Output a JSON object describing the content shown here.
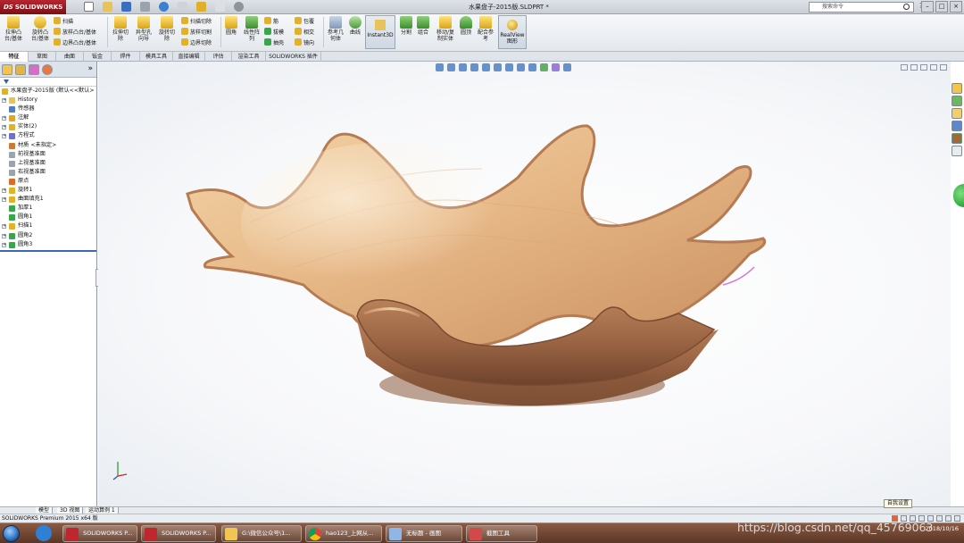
{
  "app": {
    "logo_text": "SOLIDWORKS",
    "logo_prefix": "DS",
    "document_title": "水果盘子-2015版.SLDPRT *",
    "search_placeholder": "搜索命令",
    "help_label": "? ·"
  },
  "window_controls": [
    "–",
    "□",
    "×"
  ],
  "commands": {
    "extrude_boss": "拉伸凸台/基体",
    "revolve_boss": "旋转凸台/基体",
    "sweep": "扫描",
    "loft_boss": "放样凸台/基体",
    "boundary_boss": "边界凸台/基体",
    "extrude_cut": "拉伸切除",
    "hole_wizard": "异型孔向导",
    "revolve_cut": "旋转切除",
    "swept_cut": "扫描切除",
    "lofted_cut": "放样切割",
    "boundary_cut": "边界切除",
    "fillet": "圆角",
    "linear_pattern": "线性阵列",
    "rib": "筋",
    "draft": "拔模",
    "shell": "抽壳",
    "wrap": "包覆",
    "intersect": "相交",
    "mirror": "镜向",
    "ref_geometry": "参考几何体",
    "curves": "曲线",
    "instant3d": "Instant3D",
    "split": "分割",
    "combine": "组合",
    "move_copy": "移动/复制实体",
    "indent": "圆顶",
    "mate_ref": "配合参考",
    "realview": "RealView图形"
  },
  "tabs": [
    "特征",
    "草图",
    "曲面",
    "钣金",
    "焊件",
    "模具工具",
    "直接编辑",
    "评估",
    "渲染工具",
    "SOLIDWORKS 插件"
  ],
  "feature_tree": {
    "root": "水果盘子-2015版 (默认<<默认>",
    "items": [
      {
        "label": "History",
        "expand": "+"
      },
      {
        "label": "传感器",
        "expand": ""
      },
      {
        "label": "注解",
        "expand": "+"
      },
      {
        "label": "实体(2)",
        "expand": "+"
      },
      {
        "label": "方程式",
        "expand": "+"
      },
      {
        "label": "材质 <未指定>",
        "expand": ""
      },
      {
        "label": "前视基准面",
        "expand": ""
      },
      {
        "label": "上视基准面",
        "expand": ""
      },
      {
        "label": "右视基准面",
        "expand": ""
      },
      {
        "label": "原点",
        "expand": ""
      },
      {
        "label": "旋转1",
        "expand": "+"
      },
      {
        "label": "曲面填充1",
        "expand": "+"
      },
      {
        "label": "加厚1",
        "expand": ""
      },
      {
        "label": "圆角1",
        "expand": ""
      },
      {
        "label": "扫描1",
        "expand": "+"
      },
      {
        "label": "圆角2",
        "expand": "+"
      },
      {
        "label": "圆角3",
        "expand": "+"
      }
    ]
  },
  "model_tabs": [
    "模型",
    "3D 视图",
    "运动算例 1"
  ],
  "status": {
    "left": "SOLIDWORKS Premium 2015 x64 版",
    "tooltip": "自我设置"
  },
  "taskbar": {
    "buttons": [
      {
        "label": "SOLIDWORKS P..."
      },
      {
        "label": "SOLIDWORKS P..."
      },
      {
        "label": "G:\\微信公众号\\1..."
      },
      {
        "label": "hao123_上网从..."
      },
      {
        "label": "无标题 - 画图"
      },
      {
        "label": "截图工具"
      }
    ],
    "tray_time": "",
    "tray_date": "2018/10/16",
    "watermark": "https://blog.csdn.net/qq_45769063"
  },
  "colors": {
    "logo_red": "#a3161c",
    "wood_light": "#f4d8b0",
    "wood_mid": "#d6a273",
    "wood_dark": "#8a5a3c",
    "taskbar": "#6a4030"
  }
}
